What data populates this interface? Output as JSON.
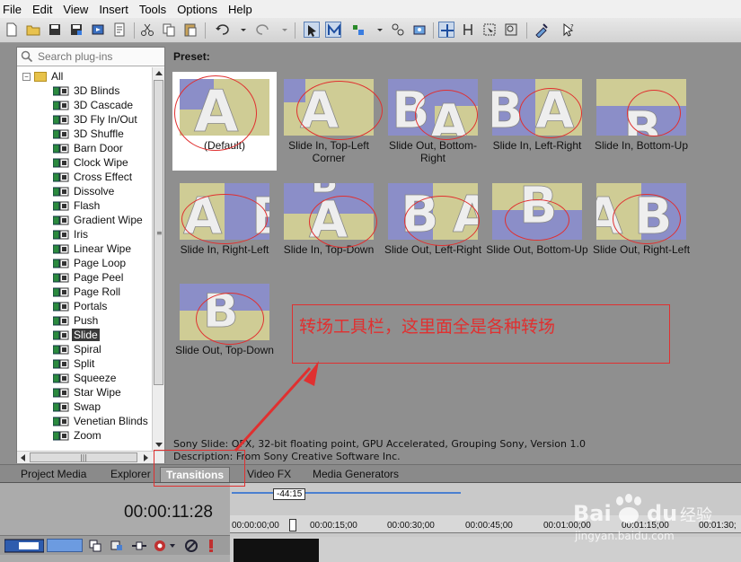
{
  "menu": [
    "File",
    "Edit",
    "View",
    "Insert",
    "Tools",
    "Options",
    "Help"
  ],
  "search": {
    "placeholder": "Search plug-ins"
  },
  "tree": {
    "root": "All",
    "items": [
      "3D Blinds",
      "3D Cascade",
      "3D Fly In/Out",
      "3D Shuffle",
      "Barn Door",
      "Clock Wipe",
      "Cross Effect",
      "Dissolve",
      "Flash",
      "Gradient Wipe",
      "Iris",
      "Linear Wipe",
      "Page Loop",
      "Page Peel",
      "Page Roll",
      "Portals",
      "Push",
      "Slide",
      "Spiral",
      "Split",
      "Squeeze",
      "Star Wipe",
      "Swap",
      "Venetian Blinds",
      "Zoom"
    ],
    "selected": "Slide"
  },
  "preset_label": "Preset:",
  "presets": [
    {
      "name": "(Default)",
      "letters": "A",
      "variant": "default"
    },
    {
      "name": "Slide In, Top-Left Corner",
      "letters": "A",
      "variant": "tl"
    },
    {
      "name": "Slide Out, Bottom-Right",
      "letters": "BA",
      "variant": "br"
    },
    {
      "name": "Slide In, Left-Right",
      "letters": "BA",
      "variant": "lr"
    },
    {
      "name": "Slide In, Bottom-Up",
      "letters": "B",
      "variant": "bu"
    },
    {
      "name": "Slide In, Right-Left",
      "letters": "AB",
      "variant": "rl"
    },
    {
      "name": "Slide In, Top-Down",
      "letters": "A",
      "variant": "td"
    },
    {
      "name": "Slide Out, Left-Right",
      "letters": "BA",
      "variant": "olr"
    },
    {
      "name": "Slide Out, Bottom-Up",
      "letters": "B",
      "variant": "obu"
    },
    {
      "name": "Slide Out, Right-Left",
      "letters": "AB",
      "variant": "orl"
    },
    {
      "name": "Slide Out, Top-Down",
      "letters": "B",
      "variant": "otd"
    }
  ],
  "description": {
    "line1": "Sony Slide: OFX, 32-bit floating point, GPU Accelerated, Grouping Sony, Version 1.0",
    "line2": "Description: From Sony Creative Software Inc."
  },
  "tabs": [
    {
      "label": "Project Media",
      "active": false
    },
    {
      "label": "Explorer",
      "active": false
    },
    {
      "label": "Transitions",
      "active": true
    },
    {
      "label": "Video FX",
      "active": false
    },
    {
      "label": "Media Generators",
      "active": false
    }
  ],
  "timeline": {
    "current_time": "00:00:11:28",
    "marker": "-44:15",
    "ticks": [
      "00:00:00;00",
      "00:00:15;00",
      "00:00:30;00",
      "00:00:45;00",
      "00:01:00;00",
      "00:01:15;00",
      "00:01:30;"
    ]
  },
  "annotation": {
    "text": "转场工具栏，这里面全是各种转场"
  },
  "watermark": {
    "brand": "Bai",
    "brand2": "du",
    "cn": "经验",
    "url": "jingyan.baidu.com"
  },
  "colors": {
    "accent_red": "#e03030",
    "thumb_blue": "#8b8ec8",
    "thumb_yellow": "#cfcc95"
  }
}
